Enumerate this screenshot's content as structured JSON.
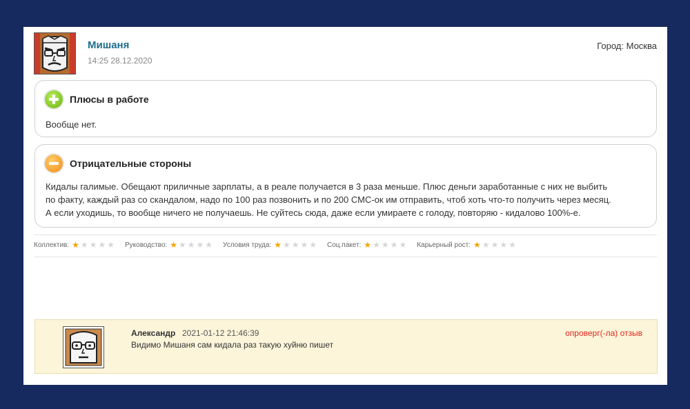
{
  "review": {
    "author": "Мишаня",
    "date": "14:25 28.12.2020",
    "city": "Город: Москва",
    "pros": {
      "title": "Плюсы в работе",
      "text": "Вообще нет."
    },
    "cons": {
      "title": "Отрицательные стороны",
      "lines": [
        "Кидалы галимые. Обещают приличные зарплаты, а в реале получается в 3 раза меньше. Плюс деньги заработанные с них не выбить",
        "по факту, каждый раз со скандалом, надо по 100 раз позвонить и по 200 СМС-ок им отправить, чтоб хоть что-то получить через месяц.",
        "А если уходишь, то вообще ничего не получаешь. Не суйтесь сюда, даже если умираете с голоду, повторяю - кидалово 100%-е."
      ]
    },
    "ratings": [
      {
        "label": "Коллектив:",
        "stars": 1,
        "max": 5
      },
      {
        "label": "Руководство:",
        "stars": 1,
        "max": 5
      },
      {
        "label": "Условия труда:",
        "stars": 1,
        "max": 5
      },
      {
        "label": "Соц.пакет:",
        "stars": 1,
        "max": 5
      },
      {
        "label": "Карьерный рост:",
        "stars": 1,
        "max": 5
      }
    ]
  },
  "comment": {
    "author": "Александр",
    "time": "2021-01-12 21:46:39",
    "text": "Видимо Мишаня сам кидала раз такую хуйню пишет",
    "dispute_label": "опроверг(-ла) отзыв"
  },
  "icons": {
    "pros_icon": "plus-circle-icon",
    "cons_icon": "minus-circle-icon",
    "star_icon": "star-icon"
  },
  "colors": {
    "background": "#172a5f",
    "author_link": "#1d6e8c",
    "star_on": "#f5a300",
    "star_off": "#d6d6d6",
    "dispute": "#e0241b",
    "comment_bg": "#fcf5da"
  }
}
